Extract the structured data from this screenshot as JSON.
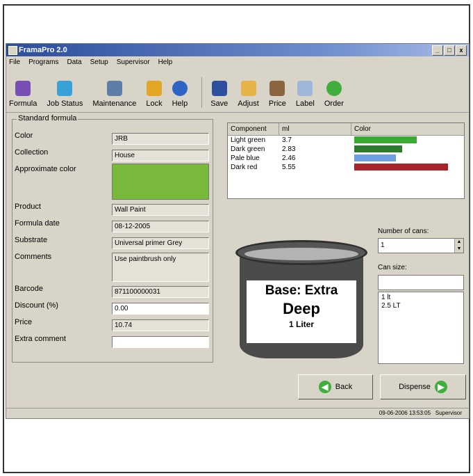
{
  "window": {
    "title": "FramaPro 2.0"
  },
  "titlebar_buttons": [
    "_",
    "□",
    "x"
  ],
  "menu": [
    "File",
    "Programs",
    "Data",
    "Setup",
    "Supervisor",
    "Help"
  ],
  "toolbar": [
    {
      "label": "Formula",
      "icon": "formula-icon",
      "color": "#7a4fb3"
    },
    {
      "label": "Job Status",
      "icon": "job-status-icon",
      "color": "#3aa1d6"
    },
    {
      "label": "Maintenance",
      "icon": "maintenance-icon",
      "color": "#5d7ea6"
    },
    {
      "label": "Lock",
      "icon": "lock-icon",
      "color": "#e3a525"
    },
    {
      "label": "Help",
      "icon": "help-icon",
      "color": "#2e64c5"
    },
    {
      "label": "Save",
      "icon": "save-icon",
      "color": "#2e4fa0"
    },
    {
      "label": "Adjust",
      "icon": "adjust-icon",
      "color": "#e6b24a"
    },
    {
      "label": "Price",
      "icon": "price-icon",
      "color": "#8b6540"
    },
    {
      "label": "Label",
      "icon": "label-icon",
      "color": "#9fb7d8"
    },
    {
      "label": "Order",
      "icon": "order-icon",
      "color": "#3fae3a"
    }
  ],
  "formula": {
    "group_title": "Standard formula",
    "color_label": "Color",
    "color_value": "JRB",
    "collection_label": "Collection",
    "collection_value": "House",
    "approx_color_label": "Approximate color",
    "approx_color_hex": "#78b83a",
    "product_label": "Product",
    "product_value": "Wall Paint",
    "date_label": "Formula date",
    "date_value": "08-12-2005",
    "substrate_label": "Substrate",
    "substrate_value": "Universal primer Grey",
    "comments_label": "Comments",
    "comments_value": "Use paintbrush only",
    "barcode_label": "Barcode",
    "barcode_value": "871100000031",
    "discount_label": "Discount (%)",
    "discount_value": "0.00",
    "price_label": "Price",
    "price_value": "10.74",
    "extra_label": "Extra comment",
    "extra_value": ""
  },
  "components": {
    "headers": [
      "Component",
      "ml",
      "Color"
    ],
    "rows": [
      {
        "name": "Light green",
        "ml": "3.7",
        "color": "#3aaa35",
        "fill": 0.6
      },
      {
        "name": "Dark green",
        "ml": "2.83",
        "color": "#2d7a2d",
        "fill": 0.46
      },
      {
        "name": "Pale blue",
        "ml": "2.46",
        "color": "#6e9fe0",
        "fill": 0.4
      },
      {
        "name": "Dark red",
        "ml": "5.55",
        "color": "#a8232b",
        "fill": 0.9
      }
    ]
  },
  "can": {
    "line1": "Base: Extra",
    "line2": "Deep",
    "line3": "1 Liter"
  },
  "cans": {
    "number_label": "Number of cans:",
    "number_value": "1",
    "size_label": "Can size:",
    "size_options": [
      "1 lt",
      "2.5 LT"
    ]
  },
  "buttons": {
    "back": "Back",
    "dispense": "Dispense"
  },
  "status": {
    "datetime": "09-06-2006 13:53:05",
    "user": "Supervisor"
  }
}
